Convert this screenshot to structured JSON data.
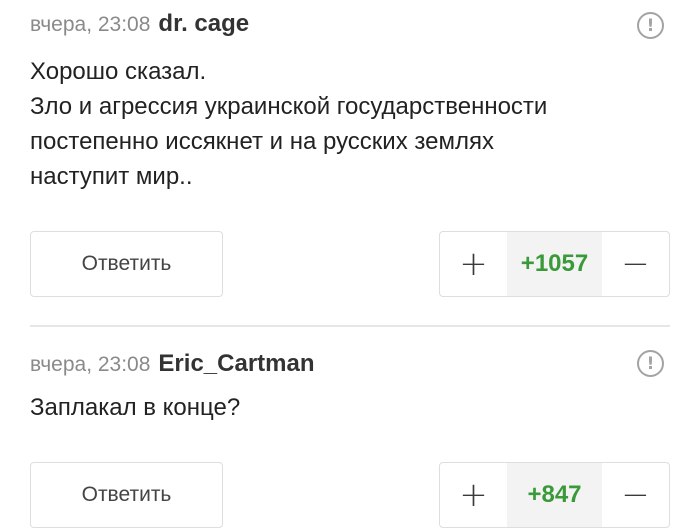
{
  "comments": [
    {
      "time": "вчера, 23:08",
      "user": "dr. cage",
      "text_lines": [
        "Хорошо сказал.",
        "Зло и агрессия украинской государственности",
        "постепенно иссякнет и на русских землях",
        "наступит мир.."
      ],
      "reply_label": "Ответить",
      "plus": "+",
      "minus": "−",
      "score": "+1057",
      "report": "!"
    },
    {
      "time": "вчера, 23:08",
      "user": "Eric_Cartman",
      "text_lines": [
        "Заплакал в конце?"
      ],
      "reply_label": "Ответить",
      "plus": "+",
      "minus": "−",
      "score": "+847",
      "report": "!"
    }
  ],
  "colors": {
    "score": "#3a9a3a",
    "muted": "#8a8a8a",
    "border": "#dedede"
  },
  "icons": {
    "report": "exclamation-circle-icon"
  }
}
